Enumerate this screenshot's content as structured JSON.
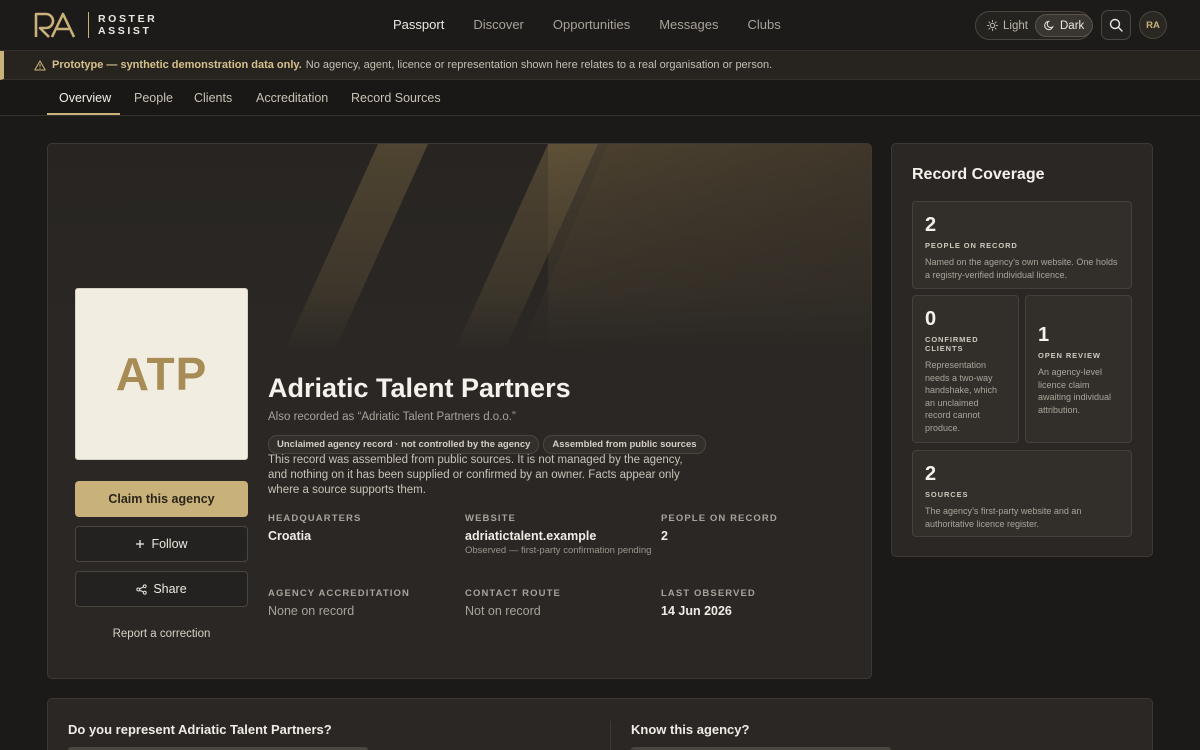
{
  "header": {
    "brand": [
      "ROSTER",
      "ASSIST"
    ],
    "nav": [
      "Passport",
      "Discover",
      "Opportunities",
      "Messages",
      "Clubs"
    ],
    "theme": {
      "light": "Light",
      "dark": "Dark"
    },
    "avatar": "RA"
  },
  "banner": {
    "bold": "Prototype — synthetic demonstration data only.",
    "text": "No agency, agent, licence or representation shown here relates to a real organisation or person."
  },
  "tabs": [
    "Overview",
    "People",
    "Clients",
    "Accreditation",
    "Record Sources"
  ],
  "agency": {
    "initials": "ATP",
    "name": "Adriatic Talent Partners",
    "aka": "Also recorded as “Adriatic Talent Partners d.o.o.”",
    "badges": [
      "Unclaimed agency record · not controlled by the agency",
      "Assembled from public sources"
    ],
    "description": "This record was assembled from public sources. It is not managed by the agency, and nothing on it has been supplied or confirmed by an owner. Facts appear only where a source supports them.",
    "actions": {
      "claim": "Claim this agency",
      "follow": "Follow",
      "share": "Share",
      "report": "Report a correction"
    },
    "facts": [
      {
        "label": "HEADQUARTERS",
        "value": "Croatia",
        "sub": ""
      },
      {
        "label": "WEBSITE",
        "value": "adriatictalent.example",
        "sub": "Observed — first-party confirmation pending"
      },
      {
        "label": "PEOPLE ON RECORD",
        "value": "2",
        "sub": ""
      },
      {
        "label": "AGENCY ACCREDITATION",
        "value": "None on record",
        "sub": ""
      },
      {
        "label": "CONTACT ROUTE",
        "value": "Not on record",
        "sub": ""
      },
      {
        "label": "LAST OBSERVED",
        "value": "14 Jun 2026",
        "sub": ""
      }
    ]
  },
  "coverage": {
    "title": "Record Coverage",
    "stats": [
      {
        "num": "2",
        "label": "PEOPLE ON RECORD",
        "text": "Named on the agency’s own website. One holds a registry-verified individual licence."
      },
      {
        "num": "0",
        "label": "CONFIRMED CLIENTS",
        "text": "Representation needs a two-way handshake, which an unclaimed record cannot produce."
      },
      {
        "num": "1",
        "label": "OPEN REVIEW",
        "text": "An agency-level licence claim awaiting individual attribution."
      },
      {
        "num": "2",
        "label": "SOURCES",
        "text": "The agency’s first-party website and an authoritative licence register."
      }
    ]
  },
  "bottom": {
    "left_title": "Do you represent Adriatic Talent Partners?",
    "right_title": "Know this agency?"
  }
}
